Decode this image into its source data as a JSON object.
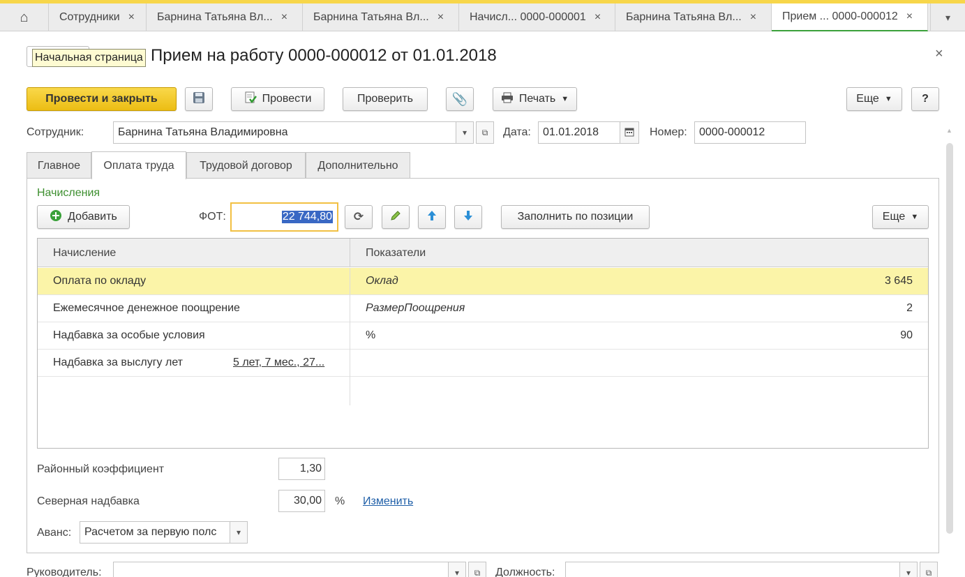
{
  "tabs": {
    "home_icon": "home-icon",
    "items": [
      {
        "label": "Сотрудники"
      },
      {
        "label": "Барнина Татьяна Вл..."
      },
      {
        "label": "Барнина Татьяна Вл..."
      },
      {
        "label": "Начисл... 0000-000001"
      },
      {
        "label": "Барнина Татьяна Вл..."
      },
      {
        "label": "Прием ... 0000-000012"
      }
    ],
    "close_glyph": "×",
    "menu_glyph": "▾"
  },
  "tooltip": "Начальная страница",
  "form": {
    "title": "Прием на работу 0000-000012 от 01.01.2018",
    "close_glyph": "×"
  },
  "toolbar": {
    "post_close": "Провести и закрыть",
    "post": "Провести",
    "check": "Проверить",
    "print": "Печать",
    "more": "Еще",
    "help": "?"
  },
  "header": {
    "employee_label": "Сотрудник:",
    "employee_value": "Барнина Татьяна Владимировна",
    "date_label": "Дата:",
    "date_value": "01.01.2018",
    "number_label": "Номер:",
    "number_value": "0000-000012"
  },
  "form_tabs": [
    "Главное",
    "Оплата труда",
    "Трудовой договор",
    "Дополнительно"
  ],
  "accruals": {
    "group_title": "Начисления",
    "add_button": "Добавить",
    "fot_label": "ФОТ:",
    "fot_value": "22 744,80",
    "fill_by_position": "Заполнить по позиции",
    "more": "Еще",
    "columns": [
      "Начисление",
      "Показатели"
    ],
    "rows": [
      {
        "name": "Оплата по окладу",
        "indicator": "Оклад",
        "value": "3 645"
      },
      {
        "name": "Ежемесячное денежное поощрение",
        "indicator": "РазмерПоощрения",
        "value": "2"
      },
      {
        "name": "Надбавка за особые условия",
        "indicator": "%",
        "value": "90"
      },
      {
        "name": "Надбавка за выслугу лет",
        "link": "5 лет, 7 мес., 27...",
        "indicator": "",
        "value": ""
      }
    ]
  },
  "bottom": {
    "district_coef_label": "Районный коэффициент",
    "district_coef_value": "1,30",
    "north_label": "Северная надбавка",
    "north_value": "30,00",
    "north_unit": "%",
    "change_link": "Изменить",
    "advance_label": "Аванс:",
    "advance_value": "Расчетом за первую полс",
    "manager_label": "Руководитель:",
    "position_label": "Должность:"
  }
}
